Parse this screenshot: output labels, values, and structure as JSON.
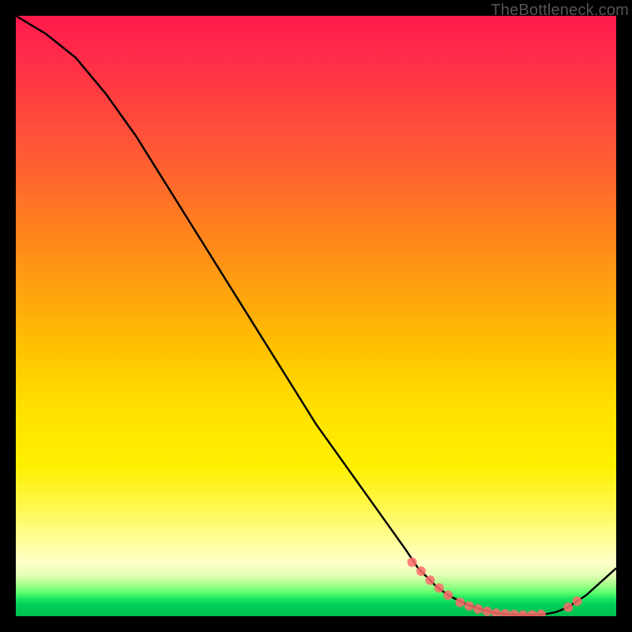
{
  "watermark": "TheBottleneck.com",
  "chart_data": {
    "type": "line",
    "title": "",
    "xlabel": "",
    "ylabel": "",
    "xlim": [
      0,
      100
    ],
    "ylim": [
      0,
      100
    ],
    "series": [
      {
        "name": "curve",
        "x": [
          0,
          5,
          10,
          15,
          20,
          25,
          30,
          35,
          40,
          45,
          50,
          55,
          60,
          65,
          67,
          70,
          72,
          75,
          78,
          80,
          82,
          85,
          88,
          90,
          92,
          95,
          100
        ],
        "y": [
          100,
          97,
          93,
          87,
          80,
          72,
          64,
          56,
          48,
          40,
          32,
          25,
          18,
          11,
          8,
          5,
          3.5,
          2,
          1,
          0.5,
          0.3,
          0.2,
          0.3,
          0.7,
          1.5,
          3.5,
          8
        ]
      }
    ],
    "markers": [
      {
        "x": 66,
        "y": 9
      },
      {
        "x": 67.5,
        "y": 7.5
      },
      {
        "x": 69,
        "y": 6
      },
      {
        "x": 70.5,
        "y": 4.7
      },
      {
        "x": 72,
        "y": 3.5
      },
      {
        "x": 74,
        "y": 2.3
      },
      {
        "x": 75.5,
        "y": 1.7
      },
      {
        "x": 77,
        "y": 1.2
      },
      {
        "x": 78.5,
        "y": 0.8
      },
      {
        "x": 80,
        "y": 0.5
      },
      {
        "x": 81.5,
        "y": 0.4
      },
      {
        "x": 83,
        "y": 0.3
      },
      {
        "x": 84.5,
        "y": 0.2
      },
      {
        "x": 86,
        "y": 0.2
      },
      {
        "x": 87.5,
        "y": 0.3
      },
      {
        "x": 92,
        "y": 1.5
      },
      {
        "x": 93.5,
        "y": 2.5
      }
    ],
    "gradient_colors": {
      "top": "#ff1a4d",
      "mid_upper": "#ff8020",
      "mid": "#ffe000",
      "mid_lower": "#ffffa0",
      "bottom": "#00c050"
    }
  }
}
